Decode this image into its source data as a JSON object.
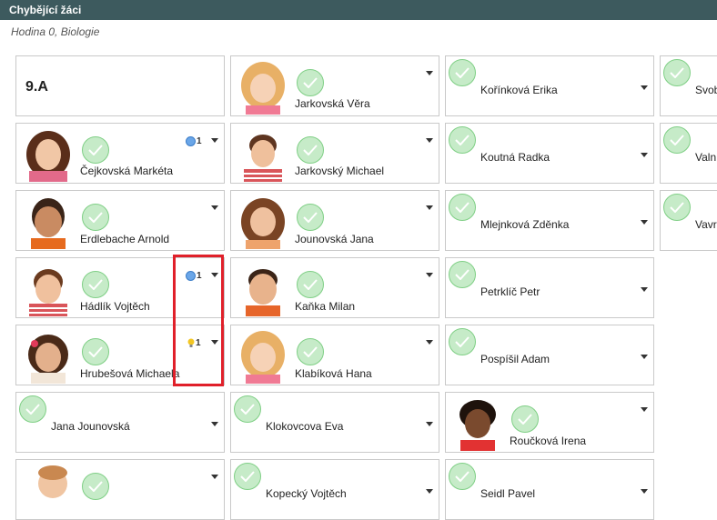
{
  "header": {
    "title": "Chybějící žáci"
  },
  "subtitle": "Hodina 0, Biologie",
  "class_label": "9.A",
  "students": {
    "c1": [
      {
        "name": "Čejkovská Markéta",
        "badge": "1",
        "badge_icon": "info-icon"
      },
      {
        "name": "Erdlebache Arnold",
        "badge": "",
        "badge_icon": ""
      },
      {
        "name": "Hádlík Vojtěch",
        "badge": "1",
        "badge_icon": "info-icon"
      },
      {
        "name": "Hrubešová Michaela",
        "badge": "1",
        "badge_icon": "lightbulb-icon"
      },
      {
        "name": "Jana Jounovská",
        "badge": "",
        "badge_icon": ""
      },
      {
        "name": "",
        "badge": "",
        "badge_icon": ""
      }
    ],
    "c2": [
      {
        "name": "Jarkovská Věra"
      },
      {
        "name": "Jarkovský Michael"
      },
      {
        "name": "Jounovská Jana"
      },
      {
        "name": "Kaňka Milan"
      },
      {
        "name": "Klabíková Hana"
      },
      {
        "name": "Klokovcova Eva"
      },
      {
        "name": "Kopecký Vojtěch"
      }
    ],
    "c3": [
      {
        "name": "Kořínková Erika"
      },
      {
        "name": "Koutná Radka"
      },
      {
        "name": "Mlejnková Zděnka"
      },
      {
        "name": "Petrklíč Petr"
      },
      {
        "name": "Pospíšil Adam"
      },
      {
        "name": "Roučková Irena"
      },
      {
        "name": "Seidl Pavel"
      }
    ],
    "c4": [
      {
        "name": "Svob"
      },
      {
        "name": "Valn"
      },
      {
        "name": "Vavr"
      }
    ]
  }
}
